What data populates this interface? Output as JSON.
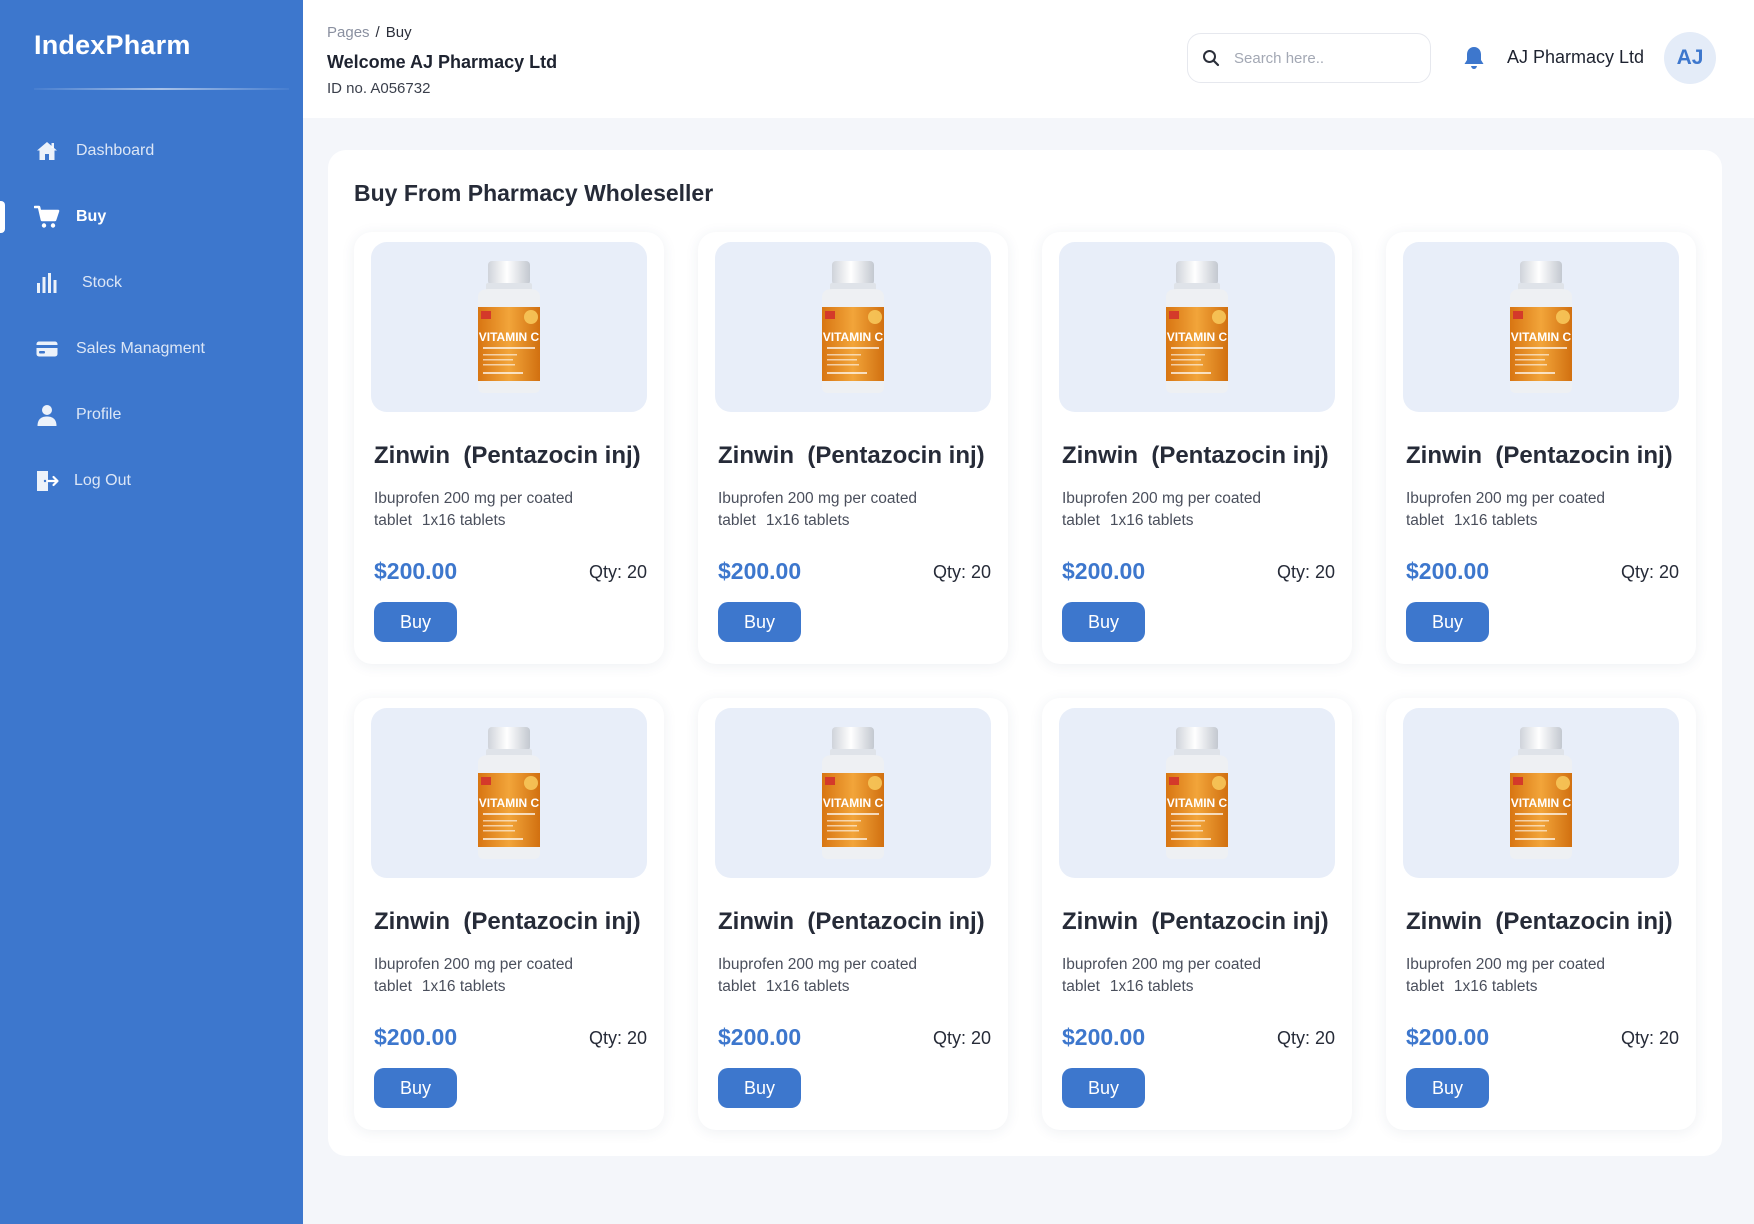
{
  "app": {
    "brand": "IndexPharm"
  },
  "sidebar": {
    "items": [
      {
        "label": "Dashboard",
        "icon": "home-icon",
        "active": false
      },
      {
        "label": "Buy",
        "icon": "cart-icon",
        "active": true
      },
      {
        "label": "Stock",
        "icon": "bar-chart-icon",
        "active": false
      },
      {
        "label": "Sales Managment",
        "icon": "card-icon",
        "active": false
      },
      {
        "label": "Profile",
        "icon": "user-icon",
        "active": false
      },
      {
        "label": "Log Out",
        "icon": "logout-icon",
        "active": false
      }
    ]
  },
  "header": {
    "breadcrumb": {
      "root": "Pages",
      "separator": "/",
      "current": "Buy"
    },
    "welcome": "Welcome AJ Pharmacy Ltd",
    "id_no": "ID no. A056732",
    "search_placeholder": "Search here..",
    "account_name": "AJ Pharmacy Ltd",
    "avatar_initials": "AJ"
  },
  "main": {
    "title": "Buy From Pharmacy Wholeseller",
    "product_image_label": "VITAMIN C",
    "products": [
      {
        "name": "Zinwin  (Pentazocin inj)",
        "desc": "Ibuprofen 200 mg per coated tablet",
        "pack": "1x16 tablets",
        "price": "$200.00",
        "qty": "Qty: 20",
        "button": "Buy"
      },
      {
        "name": "Zinwin  (Pentazocin inj)",
        "desc": "Ibuprofen 200 mg per coated tablet",
        "pack": "1x16 tablets",
        "price": "$200.00",
        "qty": "Qty: 20",
        "button": "Buy"
      },
      {
        "name": "Zinwin  (Pentazocin inj)",
        "desc": "Ibuprofen 200 mg per coated tablet",
        "pack": "1x16 tablets",
        "price": "$200.00",
        "qty": "Qty: 20",
        "button": "Buy"
      },
      {
        "name": "Zinwin  (Pentazocin inj)",
        "desc": "Ibuprofen 200 mg per coated tablet",
        "pack": "1x16 tablets",
        "price": "$200.00",
        "qty": "Qty: 20",
        "button": "Buy"
      },
      {
        "name": "Zinwin  (Pentazocin inj)",
        "desc": "Ibuprofen 200 mg per coated tablet",
        "pack": "1x16 tablets",
        "price": "$200.00",
        "qty": "Qty: 20",
        "button": "Buy"
      },
      {
        "name": "Zinwin  (Pentazocin inj)",
        "desc": "Ibuprofen 200 mg per coated tablet",
        "pack": "1x16 tablets",
        "price": "$200.00",
        "qty": "Qty: 20",
        "button": "Buy"
      },
      {
        "name": "Zinwin  (Pentazocin inj)",
        "desc": "Ibuprofen 200 mg per coated tablet",
        "pack": "1x16 tablets",
        "price": "$200.00",
        "qty": "Qty: 20",
        "button": "Buy"
      },
      {
        "name": "Zinwin  (Pentazocin inj)",
        "desc": "Ibuprofen 200 mg per coated tablet",
        "pack": "1x16 tablets",
        "price": "$200.00",
        "qty": "Qty: 20",
        "button": "Buy"
      }
    ]
  },
  "colors": {
    "sidebar": "#3d77cd",
    "accent": "#3d77cd",
    "background": "#f4f6fa",
    "card_media": "#e8eef9",
    "bottle_label": "#e58a1f"
  }
}
